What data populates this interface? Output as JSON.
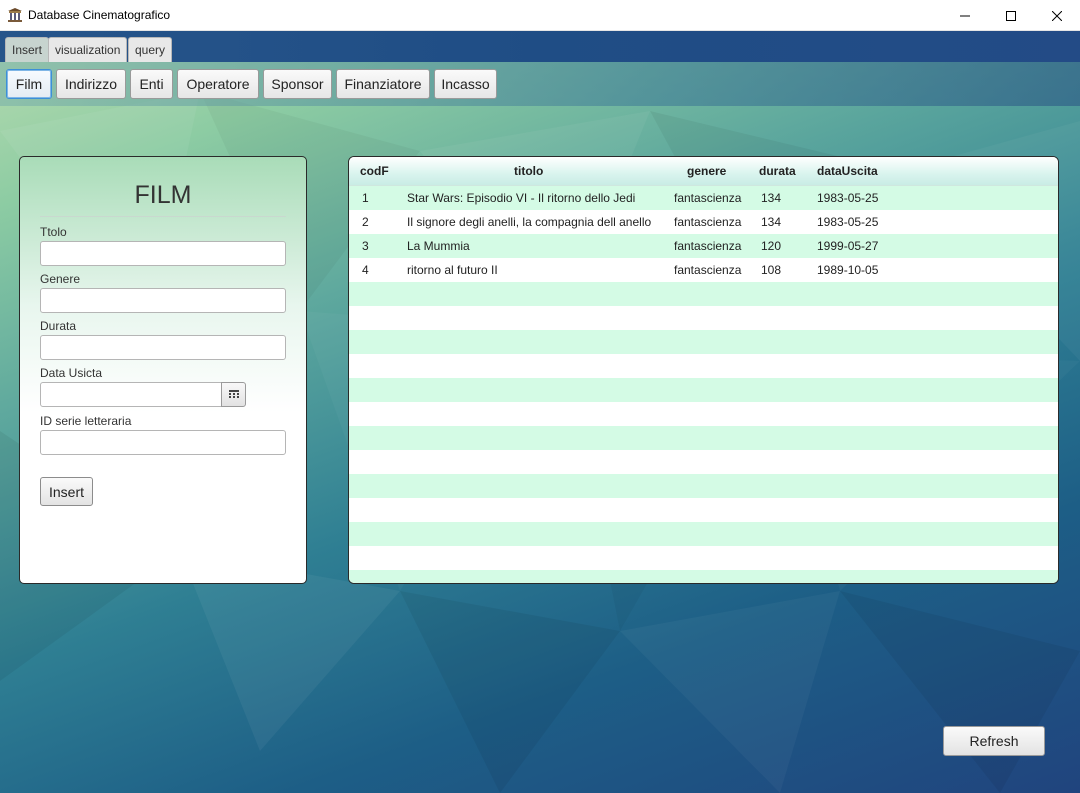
{
  "window": {
    "title": "Database Cinematografico",
    "icon": "building-icon"
  },
  "tabs": [
    {
      "label": "Insert",
      "active": true
    },
    {
      "label": "visualization",
      "active": false
    },
    {
      "label": "query",
      "active": false
    }
  ],
  "toolbar": {
    "buttons": [
      {
        "label": "Film",
        "selected": true
      },
      {
        "label": "Indirizzo",
        "selected": false
      },
      {
        "label": "Enti",
        "selected": false
      },
      {
        "label": "Operatore",
        "selected": false
      },
      {
        "label": "Sponsor",
        "selected": false
      },
      {
        "label": "Finanziatore",
        "selected": false
      },
      {
        "label": "Incasso",
        "selected": false
      }
    ]
  },
  "form": {
    "title": "FILM",
    "fields": [
      {
        "label": "Ttolo",
        "value": ""
      },
      {
        "label": "Genere",
        "value": ""
      },
      {
        "label": "Durata",
        "value": ""
      },
      {
        "label": "Data Usicta",
        "value": ""
      },
      {
        "label": "ID serie letteraria",
        "value": ""
      }
    ],
    "insert_label": "Insert"
  },
  "table": {
    "columns": [
      "codF",
      "titolo",
      "genere",
      "durata",
      "dataUscita"
    ],
    "rows": [
      [
        "1",
        "Star Wars: Episodio VI - Il ritorno dello Jedi",
        "fantascienza",
        "134",
        "1983-05-25"
      ],
      [
        "2",
        "Il signore degli anelli, la compagnia dell anello",
        "fantascienza",
        "134",
        "1983-05-25"
      ],
      [
        "3",
        "La Mummia",
        "fantascienza",
        "120",
        "1999-05-27"
      ],
      [
        "4",
        "ritorno al futuro II",
        "fantascienza",
        "108",
        "1989-10-05"
      ]
    ]
  },
  "refresh_label": "Refresh",
  "colors": {
    "row_alt": "#d4fbe5",
    "tab_band": "#1f4d85",
    "selected_border": "#3c8fd8"
  }
}
